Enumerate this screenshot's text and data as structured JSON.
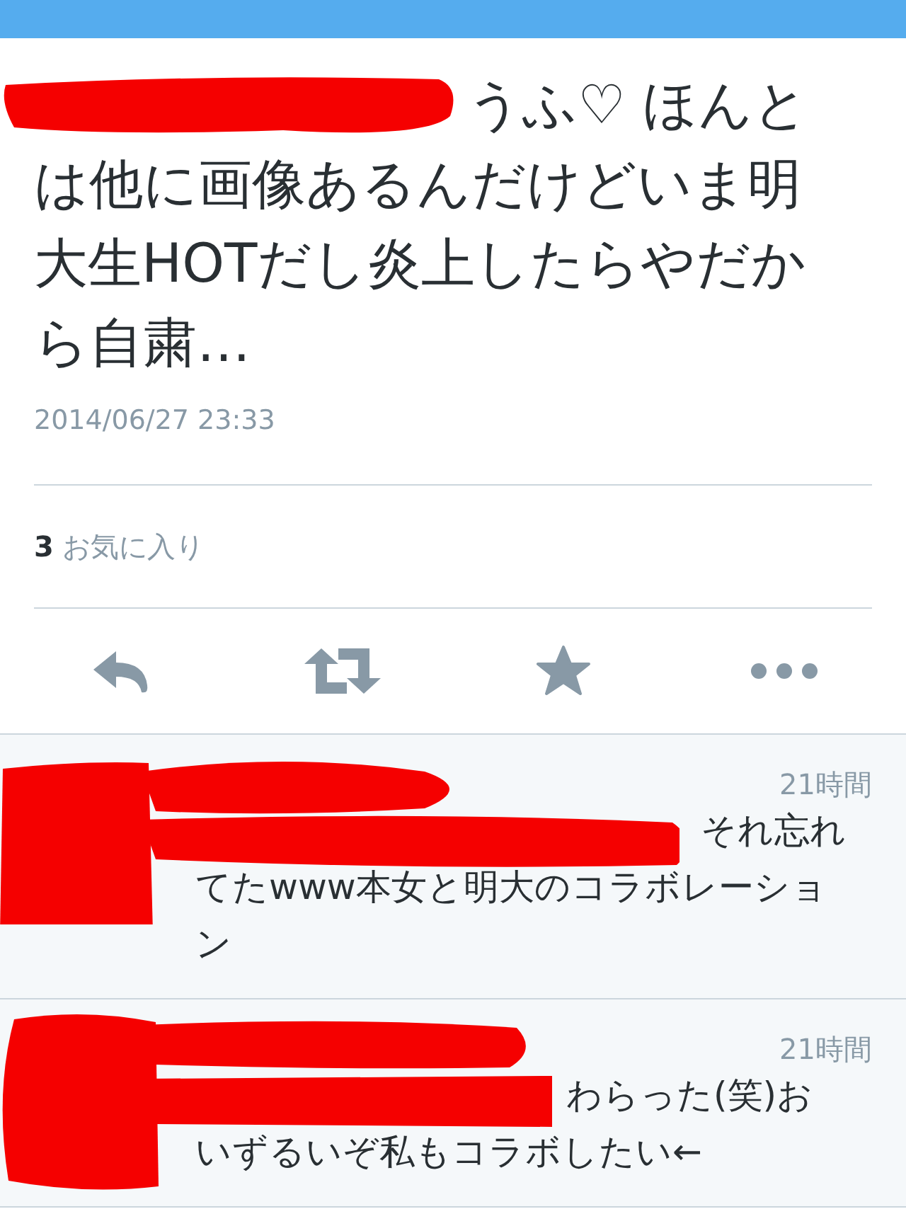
{
  "tweet": {
    "redacted": true,
    "text": "うふ♡ ほんとは他に画像あるんだけどいま明大生HOTだし炎上したらやだから自粛…",
    "timestamp": "2014/06/27 23:33",
    "favorites": {
      "count": "3",
      "label": "お気に入り"
    },
    "actions": [
      {
        "kind": "reply"
      },
      {
        "kind": "retweet"
      },
      {
        "kind": "favorite"
      },
      {
        "kind": "more"
      }
    ]
  },
  "replies": [
    {
      "redacted": true,
      "time": "21時間",
      "text": "それ忘れてたwww本女と明大のコラボレーション"
    },
    {
      "redacted": true,
      "time": "21時間",
      "text": "わらった(笑)おいずるいぞ私もコラボしたい←"
    }
  ]
}
